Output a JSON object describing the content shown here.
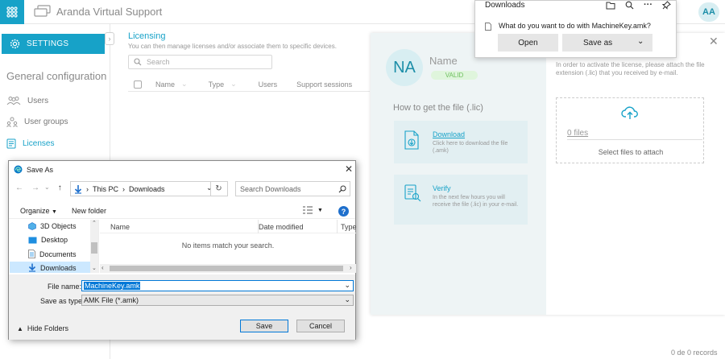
{
  "app": {
    "brand": "Aranda Virtual Support",
    "user_initials": "AA",
    "accent": "#17a2c8"
  },
  "sidebar": {
    "settings_label": "SETTINGS",
    "section_title": "General configuration",
    "items": [
      {
        "label": "Users",
        "icon": "users-icon"
      },
      {
        "label": "User groups",
        "icon": "user-groups-icon"
      },
      {
        "label": "Licenses",
        "icon": "licenses-icon"
      }
    ]
  },
  "licensing": {
    "title": "Licensing",
    "subtitle": "You can then manage licenses and/or associate them to specific devices.",
    "search_placeholder": "Search",
    "columns": [
      "Name",
      "Type",
      "Users",
      "Support sessions"
    ],
    "records": "0 de 0 records"
  },
  "license_panel": {
    "initials": "NA",
    "name": "Name",
    "status": "VALID",
    "howto_title": "How to get the file (.lic)",
    "download_title": "Download",
    "download_desc": "Click here to download the file (.amk)",
    "verify_title": "Verify",
    "verify_desc": "In the next few hours you will receive the file (.lic) in your e-mail.",
    "attach_instructions": "In order to activate the license, please attach the file extension (.lic) that you received by e-mail.",
    "files_count": "0 files",
    "select_files": "Select files to attach"
  },
  "downloads": {
    "title": "Downloads",
    "question": "What do you want to do with MachineKey.amk?",
    "open_label": "Open",
    "saveas_label": "Save as"
  },
  "save_dialog": {
    "title": "Save As",
    "path": [
      "This PC",
      "Downloads"
    ],
    "search_placeholder": "Search Downloads",
    "organize_label": "Organize",
    "new_folder_label": "New folder",
    "tree": [
      "3D Objects",
      "Desktop",
      "Documents",
      "Downloads"
    ],
    "columns": [
      "Name",
      "Date modified",
      "Type"
    ],
    "empty_message": "No items match your search.",
    "filename_label": "File name:",
    "filename_value": "MachineKey.amk",
    "savetype_label": "Save as type:",
    "savetype_value": "AMK File (*.amk)",
    "hide_folders_label": "Hide Folders",
    "save_label": "Save",
    "cancel_label": "Cancel"
  }
}
